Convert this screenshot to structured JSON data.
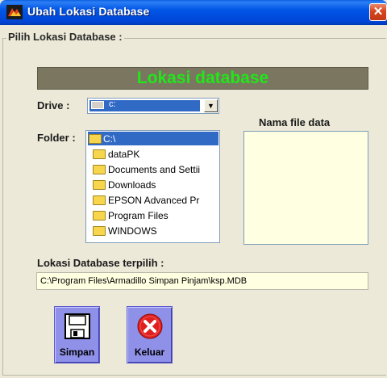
{
  "window": {
    "title": "Ubah Lokasi Database"
  },
  "group": {
    "legend": "Pilih Lokasi Database :"
  },
  "banner": {
    "text": "Lokasi database",
    "color": "#22e61a"
  },
  "drive": {
    "label": "Drive :",
    "value": "c:"
  },
  "folder": {
    "label": "Folder :",
    "items": [
      {
        "name": "C:\\",
        "selected": true
      },
      {
        "name": "dataPK"
      },
      {
        "name": "Documents and Settii"
      },
      {
        "name": "Downloads"
      },
      {
        "name": "EPSON Advanced Pr"
      },
      {
        "name": "Program Files"
      },
      {
        "name": "WINDOWS"
      }
    ]
  },
  "files": {
    "label": "Nama file data"
  },
  "selected_path": {
    "label": "Lokasi Database terpilih :",
    "value": "C:\\Program Files\\Armadillo Simpan Pinjam\\ksp.MDB"
  },
  "buttons": {
    "save_label": "Simpan",
    "exit_label": "Keluar"
  },
  "icons": {
    "app": "database-app-icon",
    "close": "close-icon",
    "drive": "drive-icon",
    "folder": "folder-icon",
    "save": "floppy-disk-icon",
    "exit": "red-x-circle-icon"
  }
}
